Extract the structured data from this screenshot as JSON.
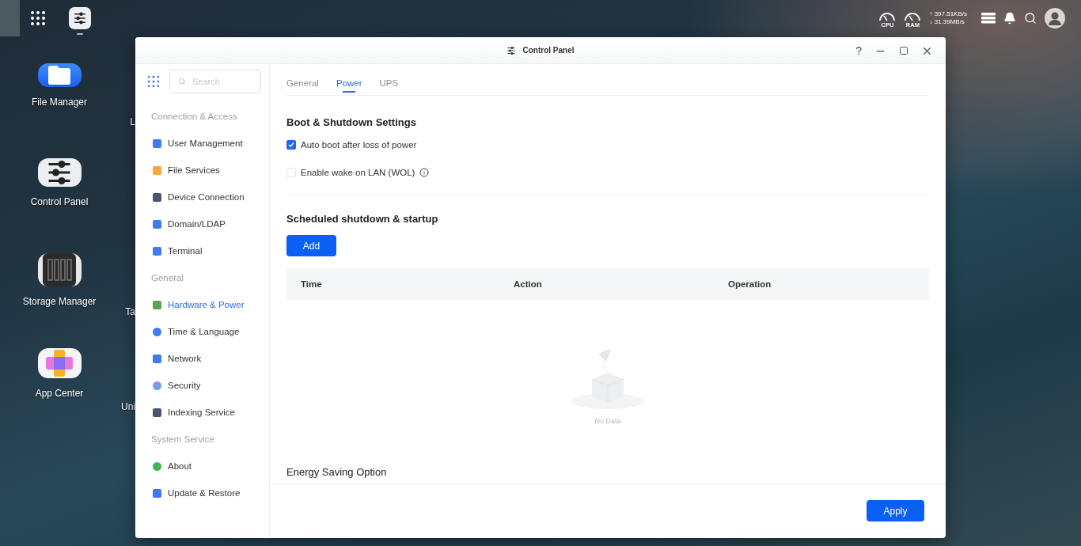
{
  "taskbar": {
    "apps": [
      {
        "running": true
      }
    ]
  },
  "system_tray": {
    "gauges": [
      {
        "label": "CPU"
      },
      {
        "label": "RAM"
      }
    ],
    "upload": "↑ 397.51KB/s",
    "download": "↓ 31.39MB/s"
  },
  "desktop": {
    "column_1": [
      {
        "label": "File Manager"
      },
      {
        "label": "Control Panel"
      },
      {
        "label": "Storage Manager"
      },
      {
        "label": "App Center"
      }
    ],
    "column_2": [
      {
        "label": "L"
      },
      {
        "label": "Ta"
      },
      {
        "label": "Uni"
      }
    ]
  },
  "window": {
    "title": "Control Panel",
    "help": "?",
    "sidebar": {
      "search": {
        "placeholder": "Search"
      },
      "groups": [
        {
          "title": "Connection & Access",
          "items": [
            {
              "label": "User Management",
              "selected": false
            },
            {
              "label": "File Services",
              "selected": false
            },
            {
              "label": "Device Connection",
              "selected": false
            },
            {
              "label": "Domain/LDAP",
              "selected": false
            },
            {
              "label": "Terminal",
              "selected": false
            }
          ]
        },
        {
          "title": "General",
          "items": [
            {
              "label": "Hardware & Power",
              "selected": true
            },
            {
              "label": "Time & Language",
              "selected": false
            },
            {
              "label": "Network",
              "selected": false
            },
            {
              "label": "Security",
              "selected": false
            },
            {
              "label": "Indexing Service",
              "selected": false
            }
          ]
        },
        {
          "title": "System Service",
          "items": [
            {
              "label": "About",
              "selected": false
            },
            {
              "label": "Update & Restore",
              "selected": false
            }
          ]
        }
      ]
    },
    "tabs": [
      {
        "label": "General",
        "selected": false
      },
      {
        "label": "Power",
        "selected": true
      },
      {
        "label": "UPS",
        "selected": false
      }
    ],
    "boot": {
      "title": "Boot & Shutdown Settings",
      "options": [
        {
          "label": "Auto boot after loss of power",
          "checked": true,
          "info": false
        },
        {
          "label": "Enable wake on LAN (WOL)",
          "checked": false,
          "info": true
        }
      ]
    },
    "schedule": {
      "title": "Scheduled shutdown & startup",
      "add_button": "Add",
      "table": {
        "columns": [
          "Time",
          "Action",
          "Operation"
        ],
        "empty_text": "No Data"
      }
    },
    "energy": {
      "title": "Energy Saving Option"
    },
    "footer": {
      "apply_button": "Apply"
    }
  }
}
